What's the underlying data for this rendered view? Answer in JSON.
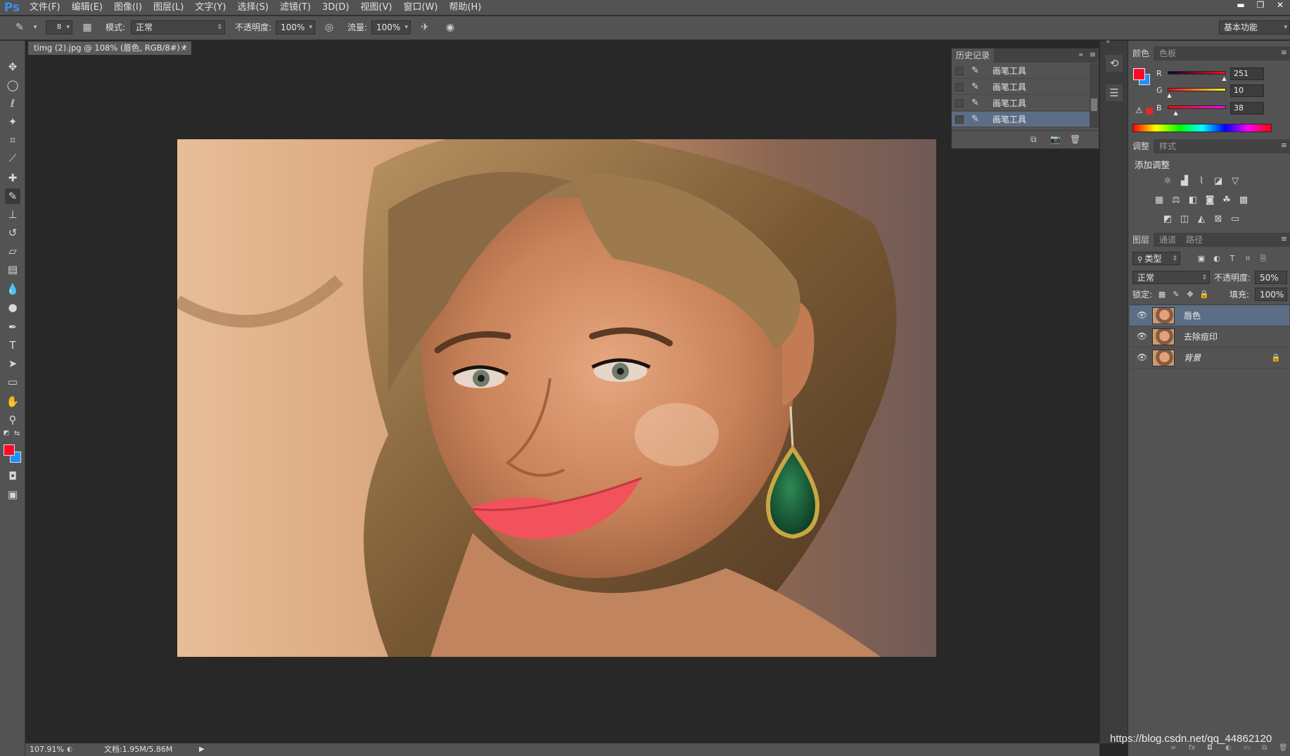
{
  "app": {
    "logo": "Ps"
  },
  "menu": [
    "文件(F)",
    "编辑(E)",
    "图像(I)",
    "图层(L)",
    "文字(Y)",
    "选择(S)",
    "滤镜(T)",
    "3D(D)",
    "视图(V)",
    "窗口(W)",
    "帮助(H)"
  ],
  "window_controls": {
    "minimize": "▬",
    "restore": "❐",
    "close": "✕"
  },
  "options": {
    "brush_size": "8",
    "mode_label": "模式:",
    "mode_value": "正常",
    "opacity_label": "不透明度:",
    "opacity_value": "100%",
    "flow_label": "流量:",
    "flow_value": "100%",
    "workspace": "基本功能"
  },
  "document": {
    "tab_title": "timg (2).jpg @ 108% (唇色, RGB/8#) *",
    "tab_close": "×",
    "zoom": "107.91%",
    "doc_info": "文档:1.95M/5.86M"
  },
  "history": {
    "tab": "历史记录",
    "items": [
      "画笔工具",
      "画笔工具",
      "画笔工具",
      "画笔工具"
    ],
    "selected_index": 3
  },
  "color_panel": {
    "tabs": [
      "颜色",
      "色板"
    ],
    "foreground": "#fb0a26",
    "background": "#1e90ff",
    "channels": [
      {
        "label": "R",
        "value": "251",
        "fraction": 0.98
      },
      {
        "label": "G",
        "value": "10",
        "fraction": 0.04
      },
      {
        "label": "B",
        "value": "38",
        "fraction": 0.15
      }
    ]
  },
  "adjustments": {
    "tabs": [
      "调整",
      "样式"
    ],
    "title": "添加调整"
  },
  "layers": {
    "tabs": [
      "图层",
      "通道",
      "路径"
    ],
    "filter": "类型",
    "blend_mode": "正常",
    "opacity_label": "不透明度:",
    "opacity_value": "50%",
    "lock_label": "锁定:",
    "fill_label": "填充:",
    "fill_value": "100%",
    "items": [
      {
        "name": "唇色",
        "selected": true
      },
      {
        "name": "去除痘印",
        "selected": false
      },
      {
        "name": "背景",
        "selected": false,
        "locked": true
      }
    ]
  },
  "watermark": "https://blog.csdn.net/qq_44862120"
}
